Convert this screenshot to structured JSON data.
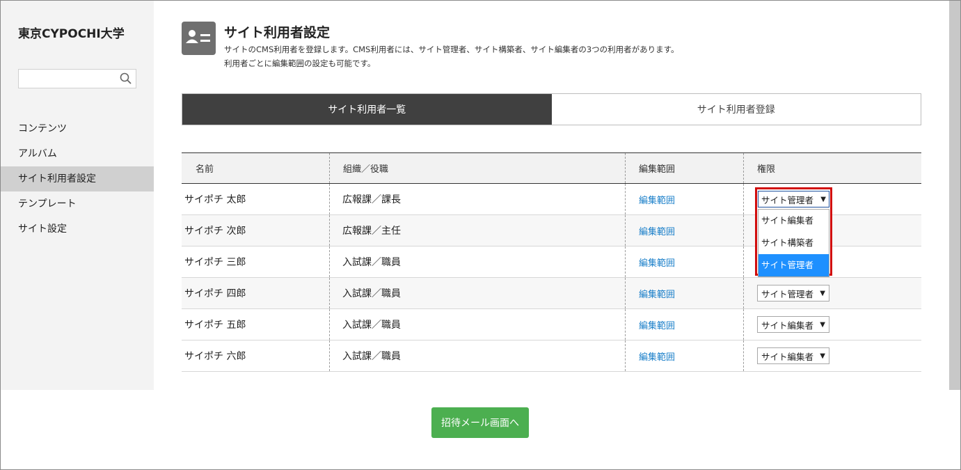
{
  "sidebar": {
    "brand": "東京CYPOCHI大学",
    "search": {
      "value": "",
      "placeholder": ""
    },
    "items": [
      {
        "label": "コンテンツ",
        "active": false
      },
      {
        "label": "アルバム",
        "active": false
      },
      {
        "label": "サイト利用者設定",
        "active": true
      },
      {
        "label": "テンプレート",
        "active": false
      },
      {
        "label": "サイト設定",
        "active": false
      }
    ]
  },
  "header": {
    "icon": "user-card-icon",
    "title": "サイト利用者設定",
    "desc_line1": "サイトのCMS利用者を登録します。CMS利用者には、サイト管理者、サイト構築者、サイト編集者の3つの利用者があります。",
    "desc_line2": "利用者ごとに編集範囲の設定も可能です。"
  },
  "tabs": [
    {
      "label": "サイト利用者一覧",
      "active": true
    },
    {
      "label": "サイト利用者登録",
      "active": false
    }
  ],
  "table": {
    "headers": [
      "名前",
      "組織／役職",
      "編集範囲",
      "権限"
    ],
    "rows": [
      {
        "name": "サイポチ 太郎",
        "org": "広報課／課長",
        "scope": "編集範囲",
        "role": "サイト管理者"
      },
      {
        "name": "サイポチ 次郎",
        "org": "広報課／主任",
        "scope": "編集範囲",
        "role": ""
      },
      {
        "name": "サイポチ 三郎",
        "org": "入試課／職員",
        "scope": "編集範囲",
        "role": ""
      },
      {
        "name": "サイポチ 四郎",
        "org": "入試課／職員",
        "scope": "編集範囲",
        "role": "サイト管理者"
      },
      {
        "name": "サイポチ 五郎",
        "org": "入試課／職員",
        "scope": "編集範囲",
        "role": "サイト編集者"
      },
      {
        "name": "サイポチ 六郎",
        "org": "入試課／職員",
        "scope": "編集範囲",
        "role": "サイト編集者"
      }
    ]
  },
  "dropdown": {
    "current": "サイト管理者",
    "options": [
      "サイト編集者",
      "サイト構築者",
      "サイト管理者"
    ],
    "selected": "サイト管理者"
  },
  "invite_button": "招待メール画面へ",
  "colors": {
    "accent_green": "#4caf50",
    "tab_active": "#404040",
    "link": "#1a7fc9",
    "highlight_border": "#d10d0d",
    "option_selected": "#1e90ff"
  }
}
